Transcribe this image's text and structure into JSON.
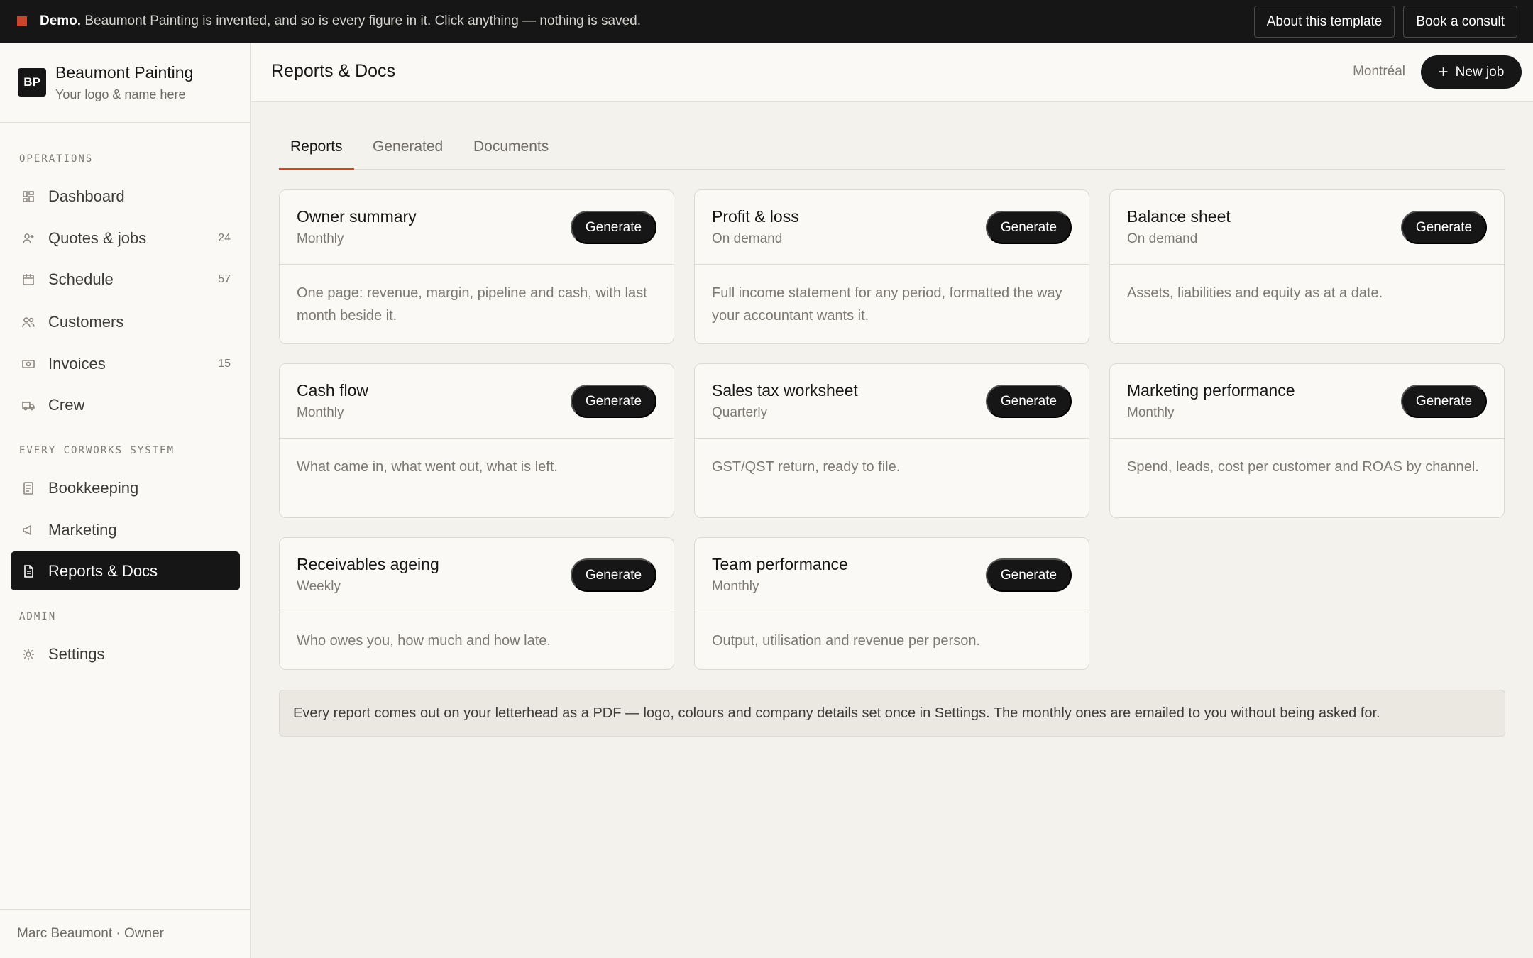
{
  "banner": {
    "label": "Demo.",
    "text": "Beaumont Painting is invented, and so is every figure in it. Click anything — nothing is saved.",
    "about_label": "About this template",
    "consult_label": "Book a consult",
    "accent_color": "#c9462c"
  },
  "brand": {
    "initials": "BP",
    "name": "Beaumont Painting",
    "tagline": "Your logo & name here"
  },
  "sidebar": {
    "sections": [
      {
        "label": "OPERATIONS",
        "items": [
          {
            "label": "Dashboard",
            "icon": "dashboard-icon",
            "count": ""
          },
          {
            "label": "Quotes & jobs",
            "icon": "user-plus-icon",
            "count": "24"
          },
          {
            "label": "Schedule",
            "icon": "calendar-icon",
            "count": "57"
          },
          {
            "label": "Customers",
            "icon": "users-icon",
            "count": ""
          },
          {
            "label": "Invoices",
            "icon": "banknote-icon",
            "count": "15"
          },
          {
            "label": "Crew",
            "icon": "truck-icon",
            "count": ""
          }
        ]
      },
      {
        "label": "EVERY CORWORKS SYSTEM",
        "items": [
          {
            "label": "Bookkeeping",
            "icon": "ledger-icon",
            "count": ""
          },
          {
            "label": "Marketing",
            "icon": "megaphone-icon",
            "count": ""
          },
          {
            "label": "Reports & Docs",
            "icon": "document-icon",
            "count": "",
            "active": true
          }
        ]
      },
      {
        "label": "ADMIN",
        "items": [
          {
            "label": "Settings",
            "icon": "gear-icon",
            "count": ""
          }
        ]
      }
    ],
    "user": "Marc Beaumont · Owner"
  },
  "header": {
    "title": "Reports & Docs",
    "city": "Montréal",
    "new_job_label": "New job"
  },
  "tabs": [
    {
      "label": "Reports",
      "active": true
    },
    {
      "label": "Generated",
      "active": false
    },
    {
      "label": "Documents",
      "active": false
    }
  ],
  "generate_label": "Generate",
  "reports": [
    {
      "title": "Owner summary",
      "frequency": "Monthly",
      "description": "One page: revenue, margin, pipeline and cash, with last month beside it."
    },
    {
      "title": "Profit & loss",
      "frequency": "On demand",
      "description": "Full income statement for any period, formatted the way your accountant wants it."
    },
    {
      "title": "Balance sheet",
      "frequency": "On demand",
      "description": "Assets, liabilities and equity as at a date."
    },
    {
      "title": "Cash flow",
      "frequency": "Monthly",
      "description": "What came in, what went out, what is left."
    },
    {
      "title": "Sales tax worksheet",
      "frequency": "Quarterly",
      "description": "GST/QST return, ready to file."
    },
    {
      "title": "Marketing performance",
      "frequency": "Monthly",
      "description": "Spend, leads, cost per customer and ROAS by channel."
    },
    {
      "title": "Receivables ageing",
      "frequency": "Weekly",
      "description": "Who owes you, how much and how late."
    },
    {
      "title": "Team performance",
      "frequency": "Monthly",
      "description": "Output, utilisation and revenue per person."
    }
  ],
  "footer_note": "Every report comes out on your letterhead as a PDF — logo, colours and company details set once in Settings. The monthly ones are emailed to you without being asked for."
}
